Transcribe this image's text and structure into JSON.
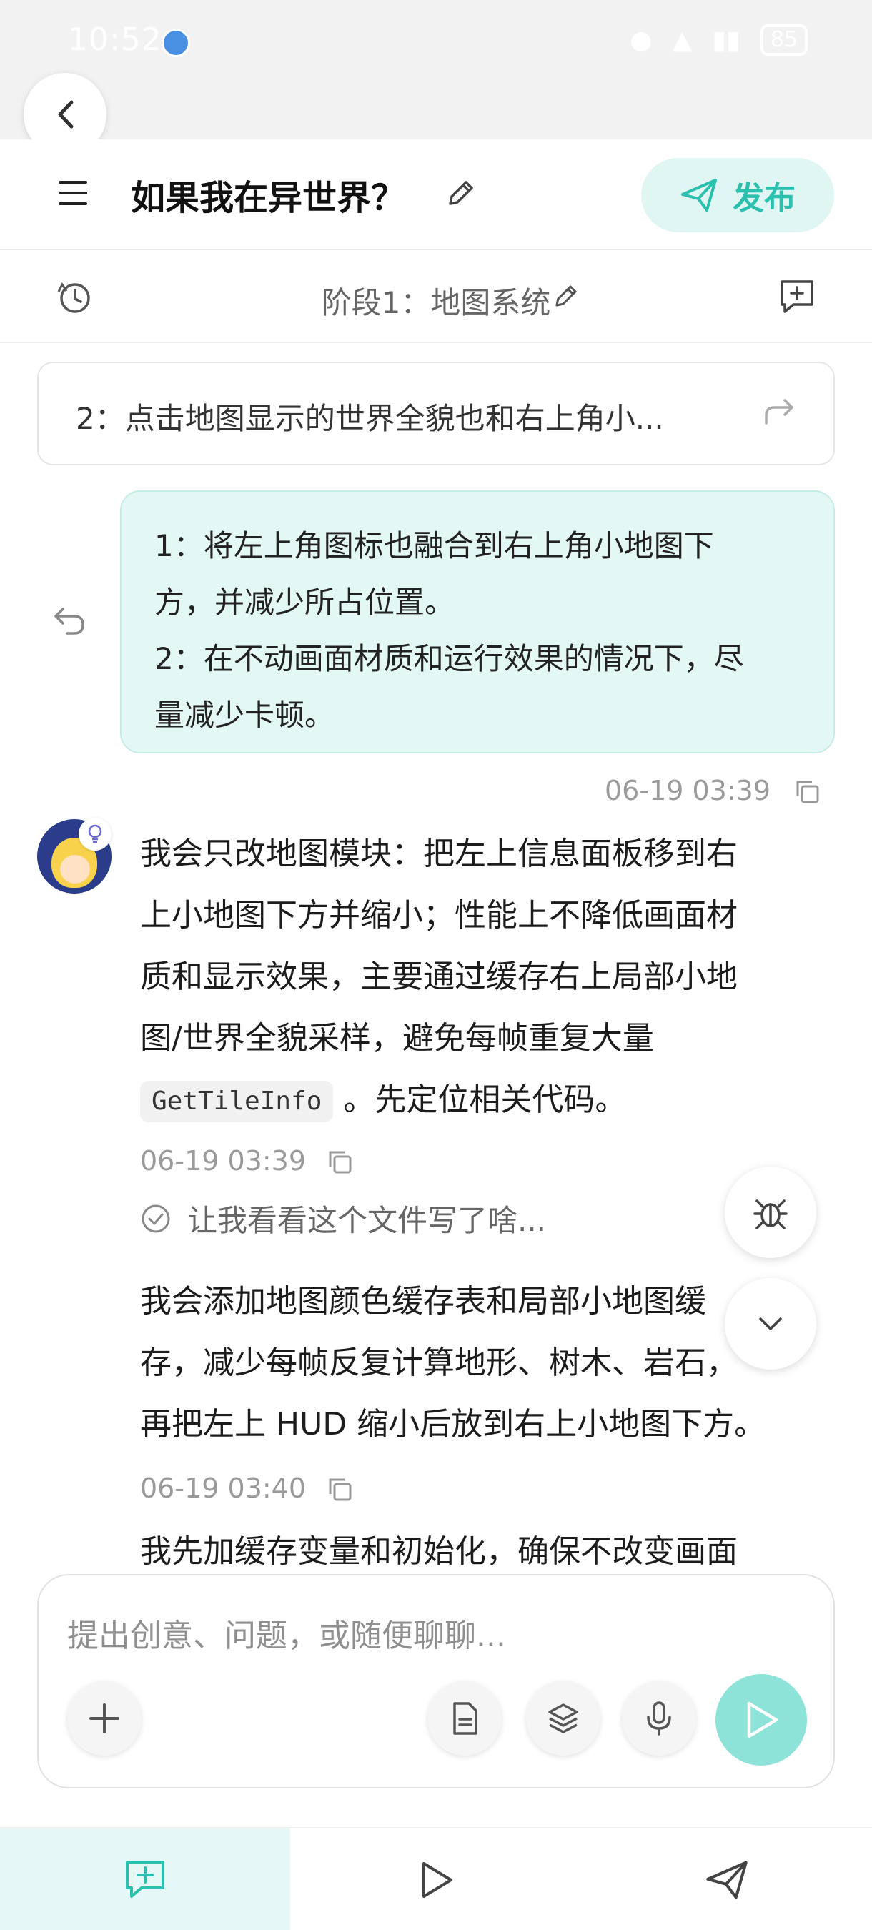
{
  "status_bar": {
    "time": "10:52",
    "battery": "85"
  },
  "header": {
    "title": "如果我在异世界？",
    "publish_label": "发布"
  },
  "stage": {
    "title": "阶段1：地图系统"
  },
  "task_card": {
    "text": "2：点击地图显示的世界全貌也和右上角小..."
  },
  "user_message": {
    "line1": "1：将左上角图标也融合到右上角小地图下",
    "line2": "方，并减少所占位置。",
    "line3": "2：在不动画面材质和运行效果的情况下，尽",
    "line4": "量减少卡顿。",
    "time": "06-19 03:39"
  },
  "assistant": {
    "msg1": {
      "line1": "我会只改地图模块：把左上信息面板移到右",
      "line2": "上小地图下方并缩小；性能上不降低画面材",
      "line3": "质和显示效果，主要通过缓存右上局部小地",
      "line4": "图/世界全貌采样，避免每帧重复大量",
      "code": "GetTileInfo",
      "line5_tail": "。先定位相关代码。",
      "time": "06-19 03:39"
    },
    "thinking": "让我看看这个文件写了啥...",
    "msg2": {
      "line1": "我会添加地图颜色缓存表和局部小地图缓",
      "line2": "存，减少每帧反复计算地形、树木、岩石，",
      "line3": "再把左上 HUD 缩小后放到右上小地图下方。",
      "time": "06-19 03:40"
    },
    "msg3_partial": "我先加缓存变量和初始化，确保不改变画面"
  },
  "composer": {
    "placeholder": "提出创意、问题，或随便聊聊..."
  },
  "colors": {
    "accent": "#2bbfae",
    "bubble_bg": "#e3f7f4",
    "send_button": "#8de3d8"
  },
  "icons": [
    "back-icon",
    "menu-icon",
    "pencil-icon",
    "send-plane-icon",
    "history-icon",
    "new-chat-icon",
    "share-arrow-icon",
    "undo-icon",
    "copy-icon",
    "check-circle-icon",
    "bug-icon",
    "chevron-down-icon",
    "plus-icon",
    "document-icon",
    "layers-icon",
    "mic-icon",
    "play-icon"
  ]
}
